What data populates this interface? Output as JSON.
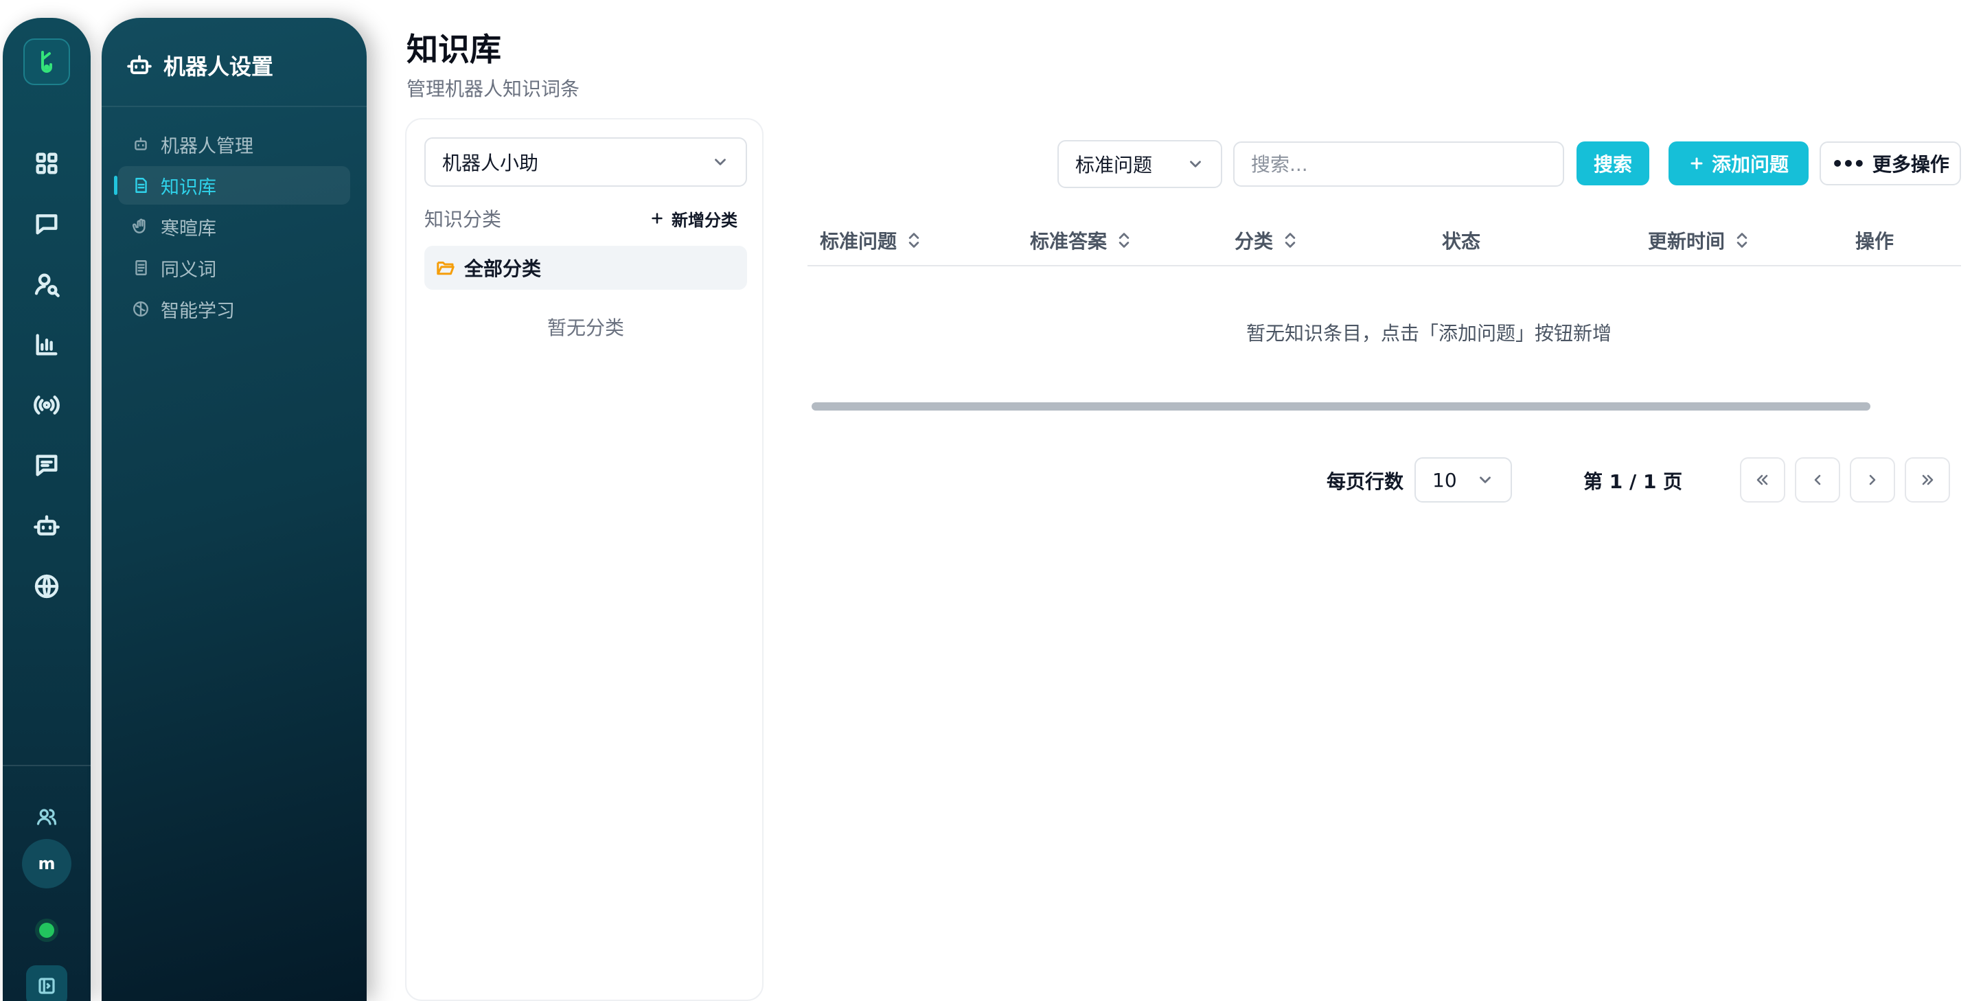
{
  "rail": {
    "avatar_initial": "m",
    "status": "online"
  },
  "settings_panel": {
    "title": "机器人设置",
    "items": [
      {
        "label": "机器人管理",
        "icon": "robot-icon",
        "active": false
      },
      {
        "label": "知识库",
        "icon": "document-icon",
        "active": true
      },
      {
        "label": "寒暄库",
        "icon": "wave-hand-icon",
        "active": false
      },
      {
        "label": "同义词",
        "icon": "notebook-icon",
        "active": false
      },
      {
        "label": "智能学习",
        "icon": "brain-icon",
        "active": false
      }
    ]
  },
  "page": {
    "title": "知识库",
    "subtitle": "管理机器人知识词条"
  },
  "categories": {
    "bot_select_value": "机器人小助",
    "heading": "知识分类",
    "add_label": "新增分类",
    "all_label": "全部分类",
    "empty_text": "暂无分类"
  },
  "toolbar": {
    "filter_value": "标准问题",
    "search_placeholder": "搜索...",
    "search_label": "搜索",
    "add_label": "添加问题",
    "more_label": "更多操作"
  },
  "table": {
    "columns": [
      {
        "label": "标准问题",
        "sortable": true
      },
      {
        "label": "标准答案",
        "sortable": true
      },
      {
        "label": "分类",
        "sortable": true
      },
      {
        "label": "状态",
        "sortable": false
      },
      {
        "label": "更新时间",
        "sortable": true
      },
      {
        "label": "操作",
        "sortable": false
      }
    ],
    "empty_text": "暂无知识条目，点击「添加问题」按钮新增"
  },
  "pagination": {
    "rows_label": "每页行数",
    "rows_value": "10",
    "page_info": "第 1 / 1 页"
  },
  "colors": {
    "accent": "#16bfd8",
    "sidebar_dark": "#0c3a4a",
    "status_online": "#22c55e",
    "folder": "#f59e0b"
  }
}
